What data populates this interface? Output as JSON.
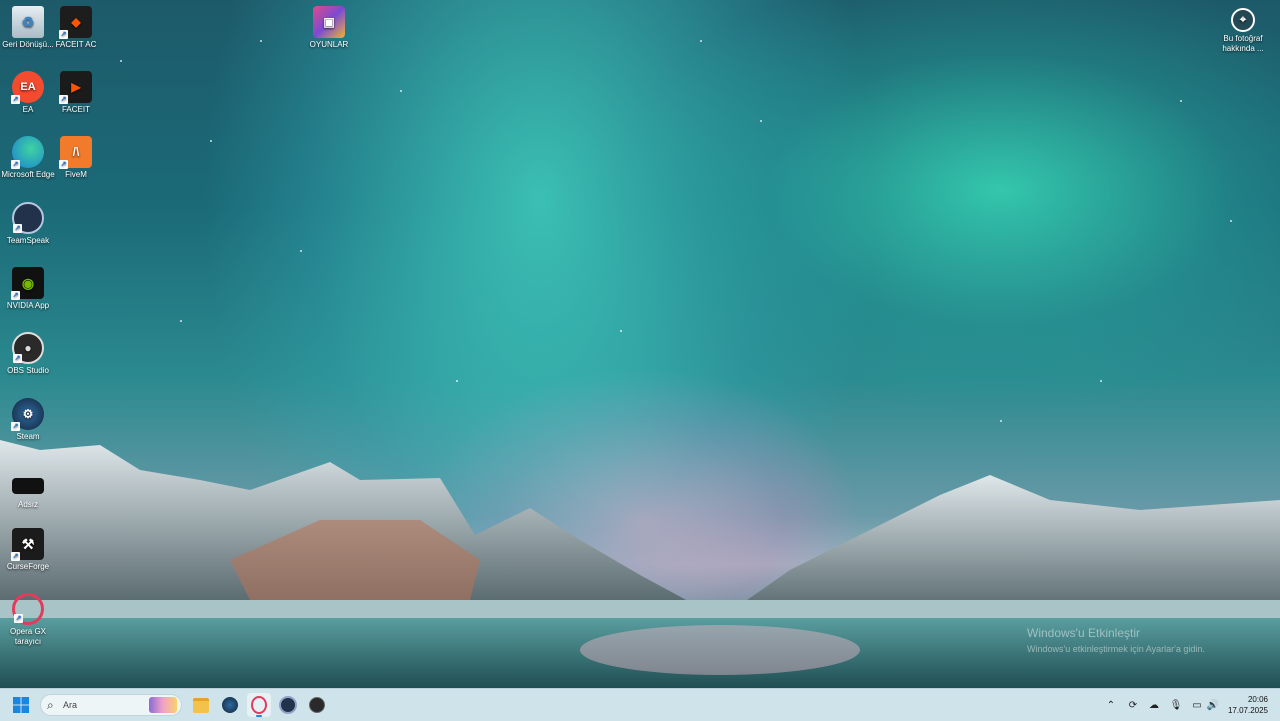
{
  "desktop": {
    "icons": [
      {
        "label": "Geri Dönüşü...",
        "icon": "recycle-bin-icon"
      },
      {
        "label": "FACEIT AC",
        "icon": "faceit-ac-icon"
      },
      {
        "label": "OYUNLAR",
        "icon": "games-folder-icon"
      },
      {
        "label": "EA",
        "icon": "ea-icon"
      },
      {
        "label": "FACEIT",
        "icon": "faceit-icon"
      },
      {
        "label": "Microsoft Edge",
        "icon": "edge-icon"
      },
      {
        "label": "FiveM",
        "icon": "fivem-icon"
      },
      {
        "label": "TeamSpeak",
        "icon": "teamspeak-icon"
      },
      {
        "label": "NVIDIA App",
        "icon": "nvidia-icon"
      },
      {
        "label": "OBS Studio",
        "icon": "obs-icon"
      },
      {
        "label": "Steam",
        "icon": "steam-icon"
      },
      {
        "label": "Adsız",
        "icon": "blank-file-icon"
      },
      {
        "label": "CurseForge",
        "icon": "curseforge-icon"
      },
      {
        "label": "Opera GX tarayıcı",
        "icon": "opera-gx-icon"
      },
      {
        "label": "Bu fotoğraf hakkında ...",
        "icon": "about-photo-icon"
      }
    ],
    "watermark": {
      "title": "Windows'u Etkinleştir",
      "subtitle": "Windows'u etkinleştirmek için Ayarlar'a gidin."
    }
  },
  "taskbar": {
    "search_placeholder": "Ara",
    "pinned": [
      "start-icon",
      "file-explorer-icon",
      "steam-icon",
      "opera-gx-icon",
      "teamspeak-icon",
      "obs-icon"
    ],
    "tray": [
      "chevron-up-icon",
      "sync-icon",
      "cloud-icon",
      "microphone-icon",
      "monitor-icon",
      "volume-icon"
    ],
    "time": "20:06",
    "date": "17.07.2025"
  },
  "colors": {
    "taskbar": "#cfe3ea",
    "aurora": "#3ee6bd"
  }
}
